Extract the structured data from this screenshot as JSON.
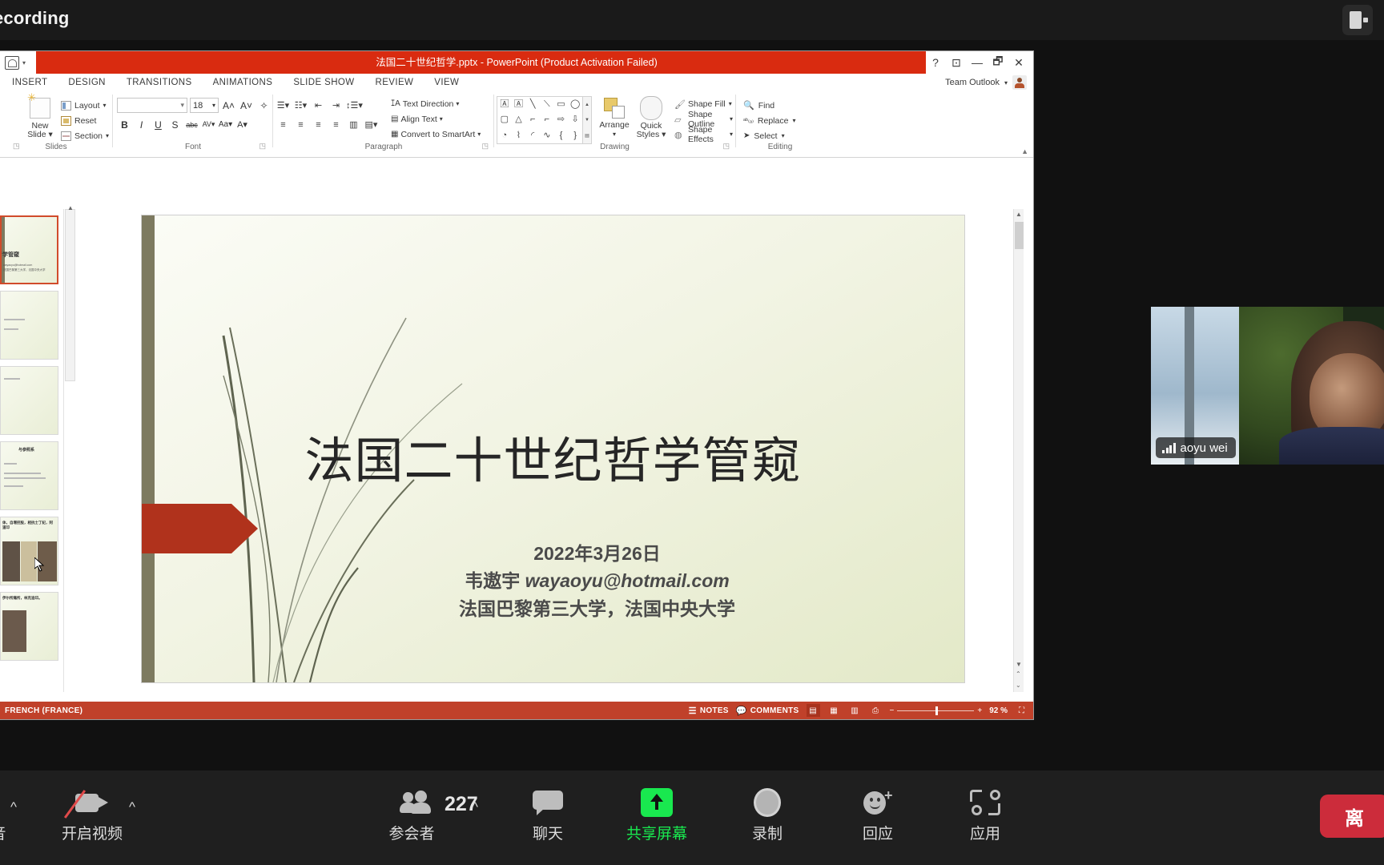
{
  "zoom_topbar": {
    "recording_label": "ecording",
    "panel_toggle_name": "view-layout-toggle"
  },
  "powerpoint": {
    "titlebar": {
      "filename": "法国二十世纪哲学.pptx",
      "separator": " -  ",
      "app": "PowerPoint (Product Activation Failed)",
      "help": "?",
      "ribbon_display": "⊡",
      "minimize": "—",
      "restore": "🗗",
      "close": "✕"
    },
    "tabs": [
      "INSERT",
      "DESIGN",
      "TRANSITIONS",
      "ANIMATIONS",
      "SLIDE SHOW",
      "REVIEW",
      "VIEW"
    ],
    "account": "Team Outlook",
    "ribbon": {
      "slides_group": {
        "caption": "Slides",
        "new_slide": "New\nSlide",
        "layout": "Layout",
        "reset": "Reset",
        "section": "Section"
      },
      "font_group": {
        "caption": "Font",
        "font_name": "",
        "font_size": "18",
        "grow": "A",
        "shrink": "A",
        "clear_format": "✎",
        "bold": "B",
        "italic": "I",
        "underline": "U",
        "shadow": "S",
        "strikethrough": "abc",
        "spacing": "AV",
        "change_case": "Aa",
        "font_color": "A"
      },
      "paragraph_group": {
        "caption": "Paragraph",
        "text_direction": "Text Direction",
        "align_text": "Align Text",
        "convert_smartart": "Convert to SmartArt"
      },
      "drawing_group": {
        "caption": "Drawing",
        "arrange": "Arrange",
        "quick_styles": "Quick\nStyles",
        "shape_fill": "Shape Fill",
        "shape_outline": "Shape Outline",
        "shape_effects": "Shape Effects"
      },
      "editing_group": {
        "caption": "Editing",
        "find": "Find",
        "replace": "Replace",
        "select": "Select"
      }
    },
    "slide": {
      "title": "法国二十世纪哲学管窥",
      "date": "2022年3月26日",
      "author_name": "韦遨宇",
      "author_email": "wayaoyu@hotmail.com",
      "affiliation": "法国巴黎第三大学，法国中央大学"
    },
    "thumbnails": [
      {
        "title": "哲学管窥",
        "has_image": false
      },
      {
        "title": "",
        "has_image": false
      },
      {
        "title": "",
        "has_image": false
      },
      {
        "title": "与参照系",
        "has_image": false
      },
      {
        "title": "体，自增控股，相抗士丁纪，阿道印",
        "has_image": true
      },
      {
        "title": "伊尔所痛所，林克迪印。",
        "has_image": true
      }
    ],
    "status_bar": {
      "language": "FRENCH (FRANCE)",
      "notes": "NOTES",
      "comments": "COMMENTS",
      "zoom_level": "92 %",
      "zoom_minus": "−",
      "zoom_plus": "+"
    }
  },
  "video_tile": {
    "participant_name": "aoyu wei"
  },
  "zoom_toolbar": {
    "audio": {
      "label": "音",
      "caret": "^"
    },
    "video": {
      "label": "开启视频",
      "caret": "^"
    },
    "participants": {
      "label": "参会者",
      "count": "227",
      "caret": "^"
    },
    "chat": {
      "label": "聊天"
    },
    "share": {
      "label": "共享屏幕",
      "color": "#19e84f"
    },
    "record": {
      "label": "录制"
    },
    "reactions": {
      "label": "回应"
    },
    "apps": {
      "label": "应用"
    },
    "leave": {
      "label": "离",
      "color": "#cc2c3b"
    }
  }
}
